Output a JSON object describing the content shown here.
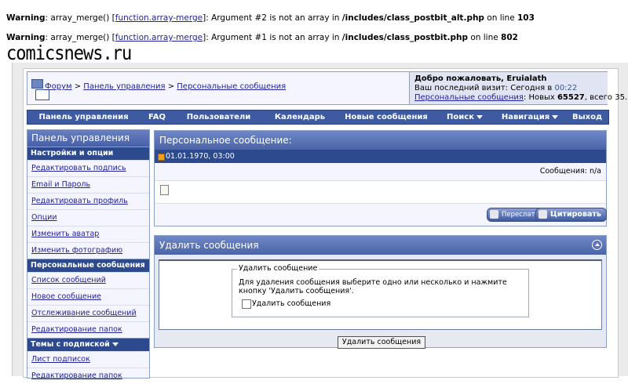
{
  "warnings": [
    {
      "label": "Warning",
      "pre": ": array_merge() [",
      "link": "function.array-merge",
      "post": "]: Argument #2 is not an array in ",
      "file": "/includes/class_postbit_alt.php",
      "online": " on line ",
      "line": "103"
    },
    {
      "label": "Warning",
      "pre": ": array_merge() [",
      "link": "function.array-merge",
      "post": "]: Argument #1 is not an array in ",
      "file": "/includes/class_postbit.php",
      "online": " on line ",
      "line": "802"
    }
  ],
  "logo": "comicsnews.ru",
  "breadcrumb": {
    "items": [
      "Форум",
      "Панель управления",
      "Персональные сообщения"
    ],
    "sep": " > "
  },
  "welcome": {
    "greeting": "Добро пожаловать, Eruialath",
    "last_visit_prefix": "Ваш последний визит: Сегодня в ",
    "last_visit_time": "00:22",
    "pm_link": "Персональные сообщения",
    "pm_new_prefix": ": Новых ",
    "pm_new": "65527",
    "pm_total_prefix": ", всего ",
    "pm_total": "35."
  },
  "menu": [
    "Панель управления",
    "FAQ",
    "Пользователи",
    "Календарь",
    "Новые сообщения",
    "Поиск",
    "Навигация",
    "Выход"
  ],
  "sidebar": {
    "title": "Панель управления",
    "sections": [
      {
        "title": "Настройки и опции",
        "items": [
          "Редактировать подпись",
          "Email и Пароль",
          "Редактировать профиль",
          "Опции",
          "Изменить аватар",
          "Изменить фотографию"
        ]
      },
      {
        "title": "Персональные сообщения",
        "items": [
          "Список сообщений",
          "Новое сообщение",
          "Отслеживание сообщений",
          "Редактирование папок"
        ]
      },
      {
        "title": "Темы с подпиской",
        "items": [
          "Лист подписок",
          "Редактирование папок"
        ]
      }
    ]
  },
  "message": {
    "title": "Персональное сообщение:",
    "date": "01.01.1970, 03:00",
    "count_label": "Сообщения: n/a",
    "forward_label": "Переслать",
    "quote_label": "Цитировать"
  },
  "delete": {
    "title": "Удалить сообщения",
    "legend": "Удалить сообщение",
    "text": "Для удаления сообщения выберите одно или несколько и нажмите кнопку 'Удалить сообщения'.",
    "checkbox_label": "Удалить сообщения",
    "button_label": "Удалить сообщения"
  },
  "colors": {
    "nav": "#3e5aa0",
    "link": "#22229c",
    "panel_bg": "#f5f5ff"
  }
}
